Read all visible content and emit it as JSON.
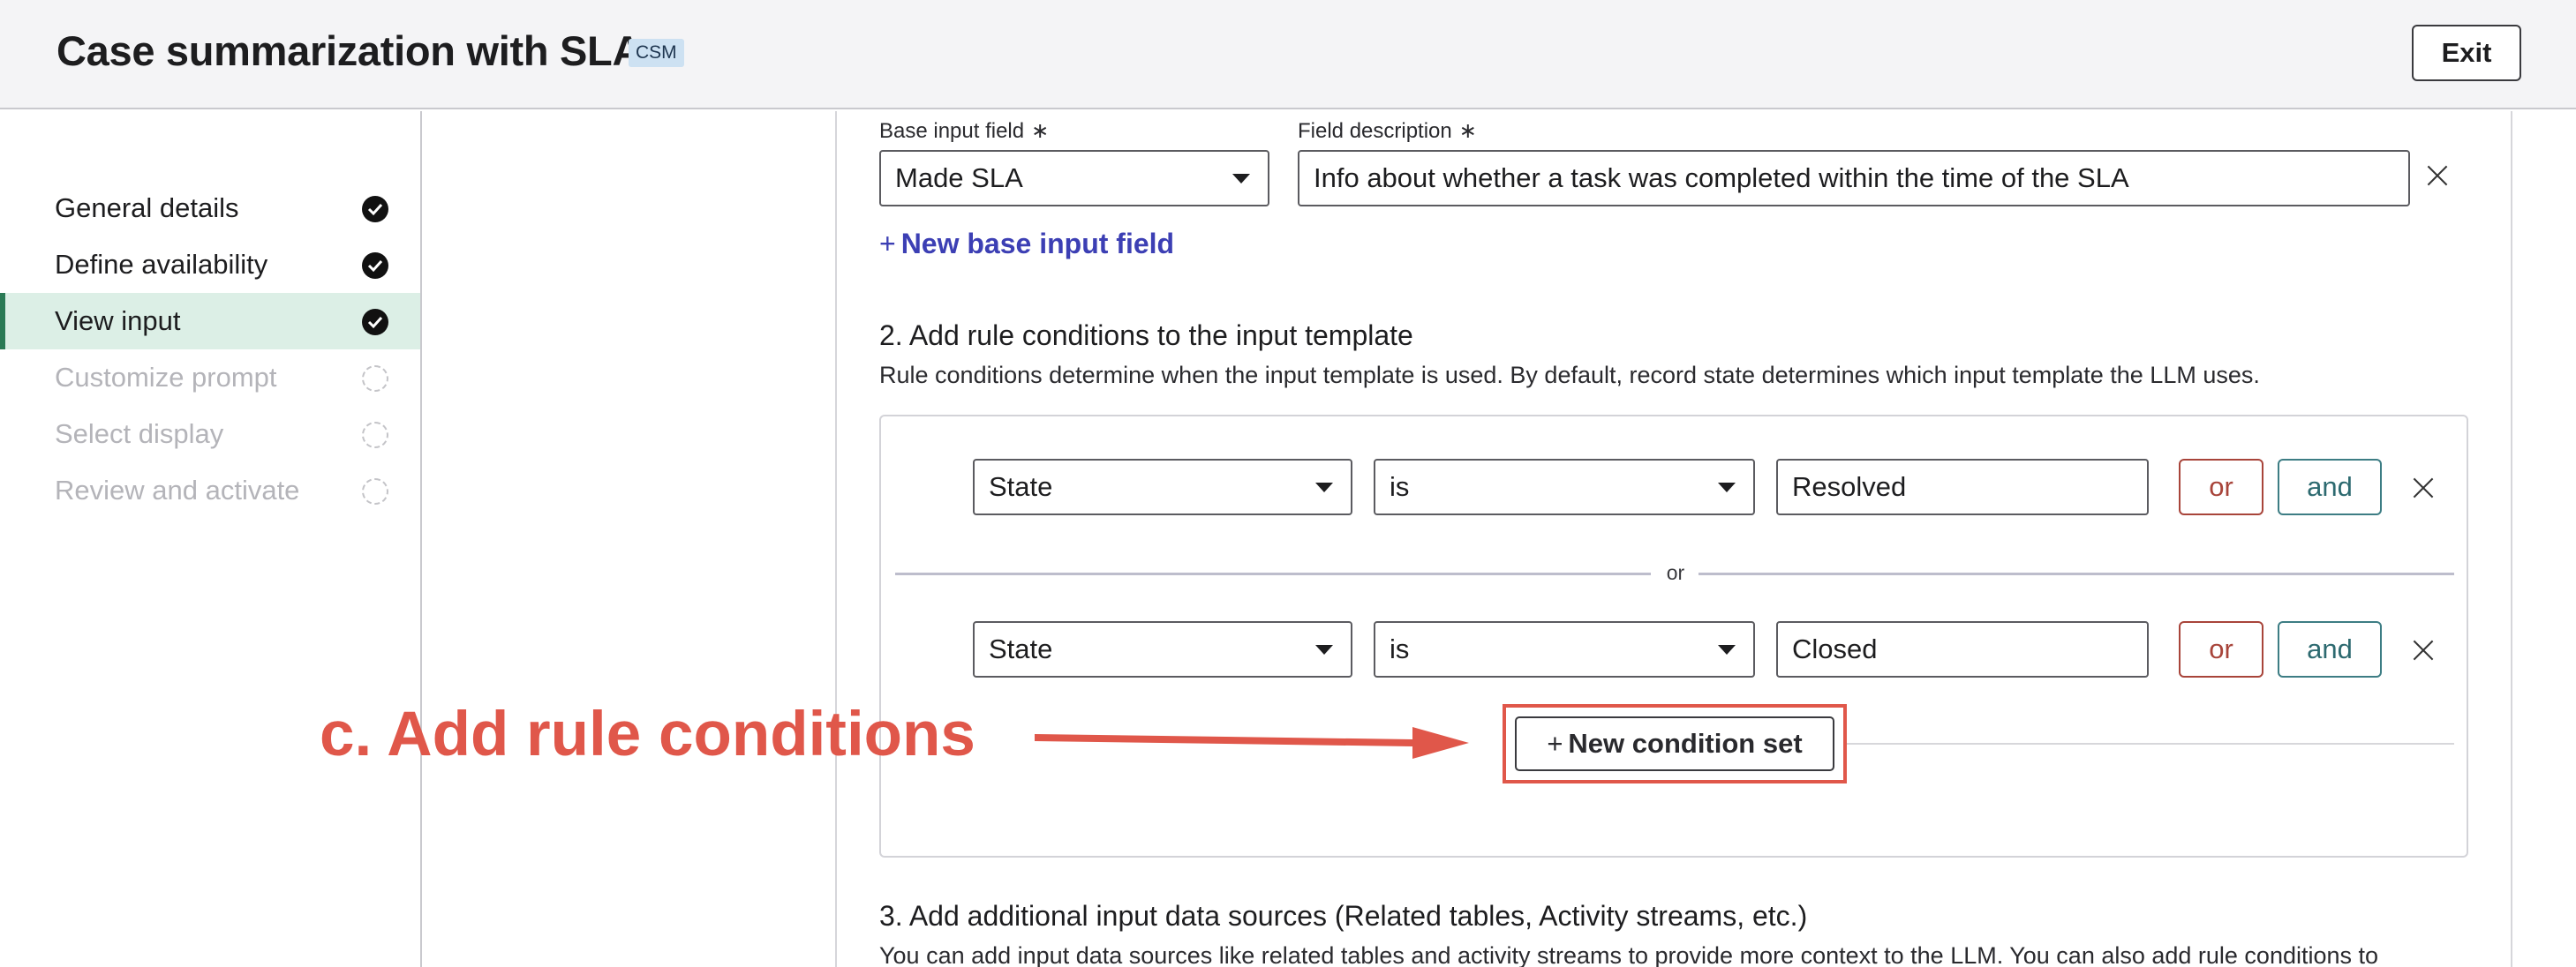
{
  "header": {
    "title": "Case summarization with SLA",
    "badge": "CSM",
    "exit_label": "Exit"
  },
  "sidebar": {
    "items": [
      {
        "label": "General details",
        "status": "complete"
      },
      {
        "label": "Define availability",
        "status": "complete"
      },
      {
        "label": "View input",
        "status": "complete",
        "active": true
      },
      {
        "label": "Customize prompt",
        "status": "pending"
      },
      {
        "label": "Select display",
        "status": "pending"
      },
      {
        "label": "Review and activate",
        "status": "pending"
      }
    ]
  },
  "base_input": {
    "field_label": "Base input field",
    "field_value": "Made SLA",
    "description_label": "Field description",
    "description_value": "Info about whether a task was completed within the time of the SLA",
    "required_marker": "∗",
    "new_field_label": "New base input field"
  },
  "rule_section": {
    "title": "2. Add rule conditions to the input template",
    "description": "Rule conditions determine when the input template is used. By default, record state determines which input template the LLM uses.",
    "conditions": [
      {
        "field": "State",
        "operator": "is",
        "value": "Resolved",
        "or_label": "or",
        "and_label": "and"
      },
      {
        "field": "State",
        "operator": "is",
        "value": "Closed",
        "or_label": "or",
        "and_label": "and"
      }
    ],
    "separator_label": "or",
    "new_condition_set_label": "New condition set"
  },
  "data_sources_section": {
    "title": "3. Add additional input data sources (Related tables, Activity streams, etc.)",
    "description": "You can add input data sources like related tables and activity streams to provide more context to the LLM. You can also add rule conditions to"
  },
  "annotation": {
    "text": "c. Add rule conditions",
    "color": "#e0574a"
  },
  "colors": {
    "active_nav_bg": "#dcefe6",
    "active_nav_accent": "#2a7a55",
    "link": "#3c3fb4",
    "or_button": "#a8443a",
    "and_button": "#2d6a70"
  }
}
